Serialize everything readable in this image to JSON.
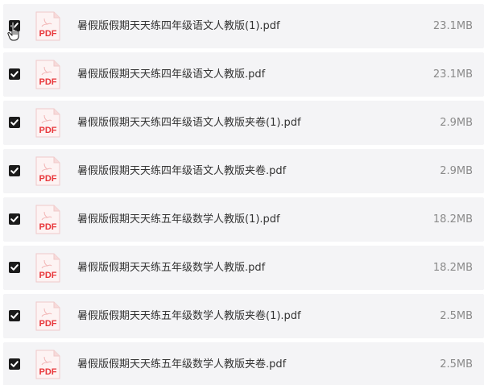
{
  "files": [
    {
      "name": "暑假版假期天天练四年级语文人教版(1).pdf",
      "size": "23.1MB",
      "checked": true,
      "icon": "pdf-icon",
      "icon_label": "PDF"
    },
    {
      "name": "暑假版假期天天练四年级语文人教版.pdf",
      "size": "23.1MB",
      "checked": true,
      "icon": "pdf-icon",
      "icon_label": "PDF"
    },
    {
      "name": "暑假版假期天天练四年级语文人教版夹卷(1).pdf",
      "size": "2.9MB",
      "checked": true,
      "icon": "pdf-icon",
      "icon_label": "PDF"
    },
    {
      "name": "暑假版假期天天练四年级语文人教版夹卷.pdf",
      "size": "2.9MB",
      "checked": true,
      "icon": "pdf-icon",
      "icon_label": "PDF"
    },
    {
      "name": "暑假版假期天天练五年级数学人教版(1).pdf",
      "size": "18.2MB",
      "checked": true,
      "icon": "pdf-icon",
      "icon_label": "PDF"
    },
    {
      "name": "暑假版假期天天练五年级数学人教版.pdf",
      "size": "18.2MB",
      "checked": true,
      "icon": "pdf-icon",
      "icon_label": "PDF"
    },
    {
      "name": "暑假版假期天天练五年级数学人教版夹卷(1).pdf",
      "size": "2.5MB",
      "checked": true,
      "icon": "pdf-icon",
      "icon_label": "PDF"
    },
    {
      "name": "暑假版假期天天练五年级数学人教版夹卷.pdf",
      "size": "2.5MB",
      "checked": true,
      "icon": "pdf-icon",
      "icon_label": "PDF"
    }
  ],
  "colors": {
    "row_bg": "#f4f4f6",
    "checkbox": "#1b1b1b",
    "pdf_red": "#e8363a",
    "name_text": "#333333",
    "size_text": "#8a8a8a"
  },
  "cursor": "hand-pointer-icon"
}
